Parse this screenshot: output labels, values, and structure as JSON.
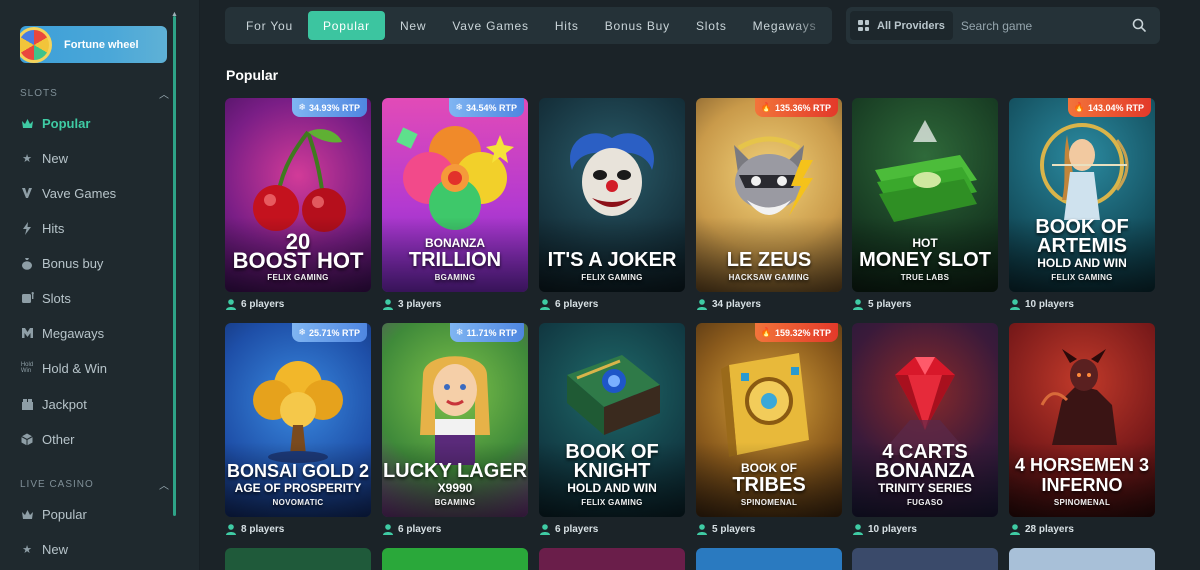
{
  "sidebar": {
    "fortune_label": "Fortune wheel",
    "sections": [
      {
        "title": "SLOTS",
        "chevron": "chevron-up-icon"
      },
      {
        "title": "LIVE CASINO",
        "chevron": "chevron-up-icon"
      }
    ],
    "slots_items": [
      {
        "label": "Popular",
        "icon": "crown-icon",
        "active": true
      },
      {
        "label": "New",
        "icon": "star-icon",
        "active": false
      },
      {
        "label": "Vave Games",
        "icon": "vave-icon",
        "active": false
      },
      {
        "label": "Hits",
        "icon": "lightning-icon",
        "active": false
      },
      {
        "label": "Bonus buy",
        "icon": "money-bag-icon",
        "active": false
      },
      {
        "label": "Slots",
        "icon": "slot-machine-icon",
        "active": false
      },
      {
        "label": "Megaways",
        "icon": "megaways-icon",
        "active": false
      },
      {
        "label": "Hold & Win",
        "icon": "hold-win-icon",
        "active": false
      },
      {
        "label": "Jackpot",
        "icon": "jackpot-icon",
        "active": false
      },
      {
        "label": "Other",
        "icon": "cube-icon",
        "active": false
      }
    ],
    "live_items": [
      {
        "label": "Popular",
        "icon": "crown-icon"
      },
      {
        "label": "New",
        "icon": "star-icon"
      }
    ]
  },
  "tabs": [
    "For You",
    "Popular",
    "New",
    "Vave Games",
    "Hits",
    "Bonus Buy",
    "Slots",
    "Megaways"
  ],
  "active_tab": "Popular",
  "providers_label": "All Providers",
  "search_placeholder": "Search game",
  "page_title": "Popular",
  "colors": {
    "accent": "#3cc5a0",
    "rtp_cold": "#4f86e0",
    "rtp_hot": "#e3392a"
  },
  "games": [
    {
      "pre": "20",
      "main": "BOOST HOT",
      "sub": "",
      "provider": "FELIX GAMING",
      "rtp": "34.93% RTP",
      "rtp_kind": "cold",
      "players": "6 players"
    },
    {
      "pre": "BONANZA",
      "main": "TRILLION",
      "sub": "",
      "provider": "BGAMING",
      "rtp": "34.54% RTP",
      "rtp_kind": "cold",
      "players": "3 players"
    },
    {
      "pre": "",
      "main": "IT'S A JOKER",
      "sub": "",
      "provider": "FELIX GAMING",
      "rtp": "",
      "rtp_kind": "",
      "players": "6 players"
    },
    {
      "pre": "",
      "main": "LE ZEUS",
      "sub": "",
      "provider": "HACKSAW GAMING",
      "rtp": "135.36% RTP",
      "rtp_kind": "hot",
      "players": "34 players"
    },
    {
      "pre": "HOT",
      "main": "MONEY SLOT",
      "sub": "",
      "provider": "TRUE LABS",
      "rtp": "",
      "rtp_kind": "",
      "players": "5 players"
    },
    {
      "pre": "",
      "main": "BOOK OF ARTEMIS",
      "sub": "HOLD AND WIN",
      "provider": "FELIX GAMING",
      "rtp": "143.04% RTP",
      "rtp_kind": "hot",
      "players": "10 players"
    },
    {
      "pre": "",
      "main": "BONSAI GOLD 2",
      "sub": "AGE OF PROSPERITY",
      "provider": "NOVOMATIC",
      "rtp": "25.71% RTP",
      "rtp_kind": "cold",
      "players": "8 players"
    },
    {
      "pre": "",
      "main": "LUCKY LAGER",
      "sub": "X9990",
      "provider": "BGAMING",
      "rtp": "11.71% RTP",
      "rtp_kind": "cold",
      "players": "6 players"
    },
    {
      "pre": "",
      "main": "BOOK OF KNIGHT",
      "sub": "HOLD AND WIN",
      "provider": "FELIX GAMING",
      "rtp": "",
      "rtp_kind": "",
      "players": "6 players"
    },
    {
      "pre": "BOOK OF",
      "main": "TRIBES",
      "sub": "",
      "provider": "SPINOMENAL",
      "rtp": "159.32% RTP",
      "rtp_kind": "hot",
      "players": "5 players"
    },
    {
      "pre": "",
      "main": "4 CARTS BONANZA",
      "sub": "TRINITY SERIES",
      "provider": "FUGASO",
      "rtp": "",
      "rtp_kind": "",
      "players": "10 players"
    },
    {
      "pre": "",
      "main": "4 HORSEMEN 3 INFERNO",
      "sub": "",
      "provider": "SPINOMENAL",
      "rtp": "",
      "rtp_kind": "",
      "players": "28 players"
    }
  ]
}
